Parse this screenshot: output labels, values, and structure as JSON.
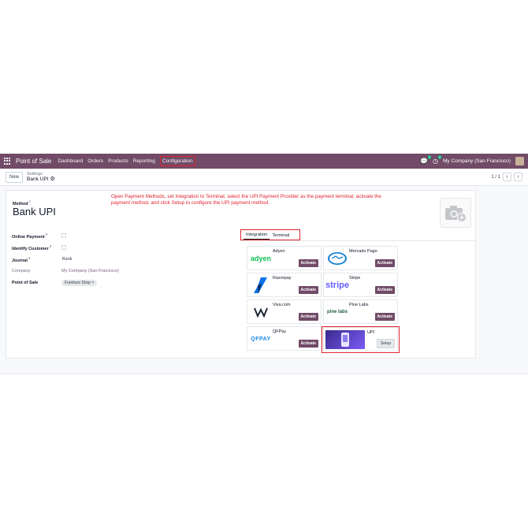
{
  "navbar": {
    "brand": "Point of Sale",
    "menu": [
      "Dashboard",
      "Orders",
      "Products",
      "Reporting",
      "Configuration"
    ],
    "active_menu": "Configuration",
    "chat_badge": "7",
    "activity_badge": "4",
    "company": "My Company (San Francisco)"
  },
  "control": {
    "new_label": "New",
    "breadcrumb_parent": "Settings",
    "breadcrumb_current": "Bank UPI",
    "pager": "1 / 1"
  },
  "instruction": "Open Payment Methods, set Integration to Terminal, select the UPI Payment Provider as the payment terminal, activate the payment method, and click Setup to configure the UPI payment method.",
  "form": {
    "method_label": "Method",
    "method_name": "Bank UPI",
    "fields": {
      "online_payment": "Online Payment",
      "identify_customer": "Identify Customer",
      "journal": "Journal",
      "journal_value": "Bank",
      "company": "Company",
      "company_value": "My Company (San Francisco)",
      "point_of_sale": "Point of Sale",
      "pos_tag": "Furniture Shop"
    }
  },
  "tabs": [
    "Integration",
    "Terminal"
  ],
  "providers": [
    {
      "name": "Adyen",
      "logo": "adyen",
      "action": "Activate"
    },
    {
      "name": "Mercado Pago",
      "logo": "",
      "action": "Activate"
    },
    {
      "name": "Razorpay",
      "logo": "",
      "action": "Activate"
    },
    {
      "name": "Stripe",
      "logo": "stripe",
      "action": "Activate"
    },
    {
      "name": "Viva.com",
      "logo": "",
      "action": "Activate"
    },
    {
      "name": "Pine Labs",
      "logo": "pine labs",
      "action": "Activate"
    },
    {
      "name": "QFPay",
      "logo": "QFPAY",
      "action": "Activate"
    },
    {
      "name": "UPI",
      "logo": "",
      "action": "Setup"
    }
  ],
  "colors": {
    "brand": "#714b67",
    "highlight": "#e0232d"
  }
}
